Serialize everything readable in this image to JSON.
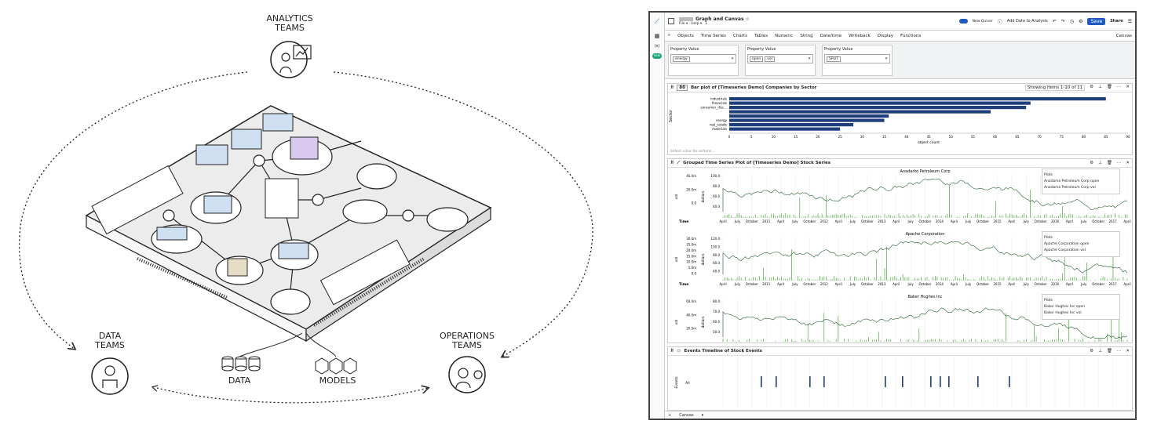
{
  "diagram": {
    "labels": {
      "analytics": "ANALYTICS TEAMS",
      "data_teams": "DATA TEAMS",
      "operations": "OPERATIONS TEAMS",
      "data": "DATA",
      "models": "MODELS"
    }
  },
  "app": {
    "breadcrumb": "Graph and Canvas ☆",
    "menus": [
      "File ▾",
      "Help ▾"
    ],
    "user_count": "1",
    "new_quiver": "New Quiver",
    "add_data": "Add Data to Analysis",
    "save": "Save",
    "share": "Share",
    "toolbar": [
      "Objects",
      "Time Series",
      "Charts",
      "Tables",
      "Numeric",
      "String",
      "Date/time",
      "Writeback",
      "Display",
      "Functions"
    ],
    "canvas_label": "Canvas",
    "side_new": "NEW",
    "side_fx": "(x)",
    "filters": [
      {
        "title": "Property Value",
        "chips": [
          "energy"
        ]
      },
      {
        "title": "Property Value",
        "chips": [
          "open",
          "vol"
        ]
      },
      {
        "title": "Property Value",
        "chips": [
          "SPLIT"
        ]
      }
    ],
    "bar_panel": {
      "title": "Bar plot of [Timeseries Demo] Companies by Sector",
      "showing": "Showing items 1-10 of 11",
      "hint": "Select a bar for actions...",
      "xlabel": "object count",
      "ylabel": "Sector",
      "id_chip": "80"
    },
    "ts_panel": {
      "title": "Grouped Time Series Plot of [Timeseries Demo] Stock Series",
      "time_label": "Time",
      "axis_ticks": [
        "April",
        "July",
        "October",
        "2011",
        "April",
        "July",
        "October",
        "2012",
        "April",
        "July",
        "October",
        "2013",
        "April",
        "July",
        "October",
        "2014",
        "April",
        "July",
        "October",
        "2015",
        "April",
        "July",
        "October",
        "2016",
        "April",
        "July",
        "October",
        "2017",
        "April"
      ],
      "plots_label": "Plots",
      "charts": [
        {
          "title": "Anadarko Petroleum Corp",
          "legend": [
            "Anadarko Petroleum Corp open",
            "Anadarko Petroleum Corp vol"
          ],
          "yticks": [
            "100.0",
            "80.0",
            "60.0",
            "40.0"
          ],
          "vticks": [
            "40.0m",
            "20.0m",
            "0.0"
          ],
          "ylabel": "dollars",
          "vlabel": "vol"
        },
        {
          "title": "Apache Corporation",
          "legend": [
            "Apache Corporation open",
            "Apache Corporation vol"
          ],
          "yticks": [
            "120.0",
            "100.0",
            "80.0",
            "60.0",
            "40.0"
          ],
          "vticks": [
            "30.0m",
            "25.0m",
            "20.0m",
            "15.0m",
            "10.0m",
            "5.0m",
            "0.0"
          ],
          "ylabel": "dollars",
          "vlabel": "vol"
        },
        {
          "title": "Baker Hughes Inc",
          "legend": [
            "Baker Hughes Inc open",
            "Baker Hughes Inc vol"
          ],
          "yticks": [
            "80.0",
            "70.0",
            "60.0",
            "50.0"
          ],
          "vticks": [
            "60.0m",
            "40.0m",
            "20.0m"
          ],
          "ylabel": "dollars",
          "vlabel": "vol"
        }
      ]
    },
    "events_panel": {
      "title": "Events Timeline of Stock Events",
      "ylabel": "Events",
      "row": "All"
    },
    "bottom_tab": "Canvas"
  },
  "chart_data": {
    "type": "bar",
    "orientation": "horizontal",
    "ylabel": "Sector",
    "xlabel": "object count",
    "categories": [
      "industrials",
      "financials",
      "consumer_disc...",
      "",
      "",
      "energy",
      "real_estate",
      "materials"
    ],
    "values": [
      85,
      68,
      67,
      59,
      36,
      35,
      28,
      25
    ],
    "xlim": [
      0,
      90
    ],
    "xticks": [
      0,
      5,
      10,
      15,
      20,
      25,
      30,
      35,
      40,
      45,
      50,
      55,
      60,
      65,
      70,
      75,
      80,
      85,
      90
    ],
    "colors": {
      "bar": "#1f3f7a",
      "line": "#1f5f2a",
      "vol": "#4aa83a"
    }
  }
}
